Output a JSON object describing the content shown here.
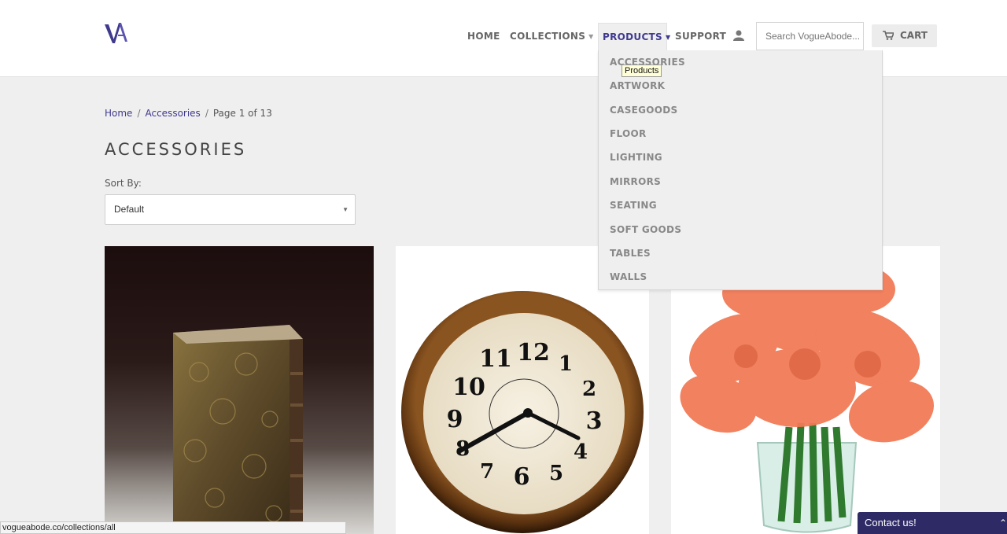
{
  "header": {
    "logo_text": "VA",
    "nav": {
      "home": "HOME",
      "collections": "COLLECTIONS",
      "products": "PRODUCTS",
      "support": "SUPPORT"
    },
    "search_placeholder": "Search VogueAbode...",
    "cart_label": "CART"
  },
  "dropdown": {
    "items": [
      "ACCESSORIES",
      "ARTWORK",
      "CASEGOODS",
      "FLOOR",
      "LIGHTING",
      "MIRRORS",
      "SEATING",
      "SOFT GOODS",
      "TABLES",
      "WALLS"
    ],
    "tooltip": "Products"
  },
  "breadcrumb": {
    "home": "Home",
    "accessories": "Accessories",
    "page": "Page 1 of 13",
    "separator": "/"
  },
  "page_title": "ACCESSORIES",
  "sort": {
    "label": "Sort By:",
    "selected": "Default"
  },
  "status_url": "vogueabode.co/collections/all",
  "contact_label": "Contact us!",
  "colors": {
    "brand": "#3f3a8e",
    "contact_bg": "#2e2a66"
  },
  "icons": [
    "person-icon",
    "cart-icon",
    "chevron-down-icon",
    "chevron-up-icon"
  ]
}
